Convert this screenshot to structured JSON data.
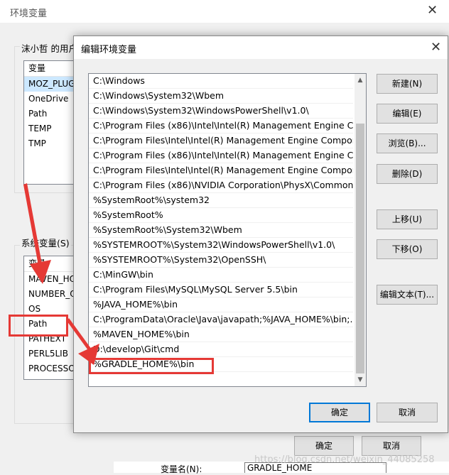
{
  "outer_dialog": {
    "title": "环境变量",
    "user_group_label": "沫小哲 的用户",
    "user_vars": {
      "header": "变量",
      "items": [
        "MOZ_PLUG",
        "OneDrive",
        "Path",
        "TEMP",
        "TMP"
      ]
    },
    "system_group_label": "系统变量(S)",
    "system_vars": {
      "header": "变量",
      "items": [
        "MAVEN_HO",
        "NUMBER_O",
        "OS",
        "Path",
        "PATHEXT",
        "PERL5LIB",
        "PROCESSO"
      ]
    },
    "ok_label": "确定",
    "cancel_label": "取消"
  },
  "edit_dialog": {
    "title": "编辑环境变量",
    "entries": [
      "C:\\Windows",
      "C:\\Windows\\System32\\Wbem",
      "C:\\Windows\\System32\\WindowsPowerShell\\v1.0\\",
      "C:\\Program Files (x86)\\Intel\\Intel(R) Management Engine Co...",
      "C:\\Program Files\\Intel\\Intel(R) Management Engine Compon...",
      "C:\\Program Files (x86)\\Intel\\Intel(R) Management Engine Co...",
      "C:\\Program Files\\Intel\\Intel(R) Management Engine Compon...",
      "C:\\Program Files (x86)\\NVIDIA Corporation\\PhysX\\Common",
      "%SystemRoot%\\system32",
      "%SystemRoot%",
      "%SystemRoot%\\System32\\Wbem",
      "%SYSTEMROOT%\\System32\\WindowsPowerShell\\v1.0\\",
      "%SYSTEMROOT%\\System32\\OpenSSH\\",
      "C:\\MinGW\\bin",
      "C:\\Program Files\\MySQL\\MySQL Server 5.5\\bin",
      "%JAVA_HOME%\\bin",
      "C:\\ProgramData\\Oracle\\Java\\javapath;%JAVA_HOME%\\bin;...",
      "%MAVEN_HOME%\\bin",
      "D:\\develop\\Git\\cmd",
      "%GRADLE_HOME%\\bin"
    ],
    "buttons": {
      "new": "新建(N)",
      "edit": "编辑(E)",
      "browse": "浏览(B)...",
      "delete": "删除(D)",
      "move_up": "上移(U)",
      "move_down": "下移(O)",
      "edit_text": "编辑文本(T)...",
      "ok": "确定",
      "cancel": "取消"
    }
  },
  "bottom_bar": {
    "var_name_label": "变量名(N):",
    "var_name_value": "GRADLE_HOME"
  },
  "watermark": "https://blog.csdn.net/weixin_44085258",
  "colors": {
    "annotation_red": "#e53935",
    "primary_border": "#0078d7"
  }
}
